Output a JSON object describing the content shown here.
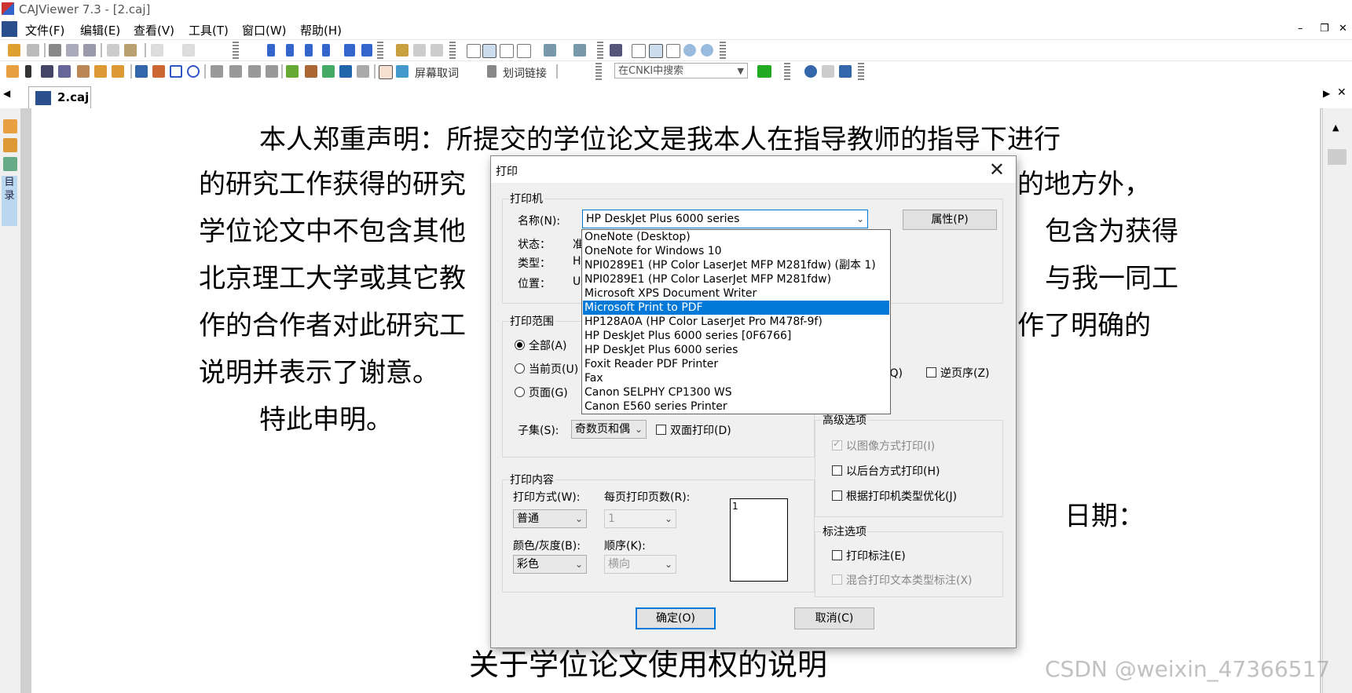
{
  "window": {
    "title": "CAJViewer 7.3 - [2.caj]"
  },
  "menubar": {
    "items": [
      "文件(F)",
      "编辑(E)",
      "查看(V)",
      "工具(T)",
      "窗口(W)",
      "帮助(H)"
    ]
  },
  "toolbar2": {
    "screen_fetch_label": "屏幕取词",
    "word_link_label": "划词链接",
    "search_placeholder": "在CNKI中搜索"
  },
  "tabs": [
    {
      "label": "2.caj"
    }
  ],
  "left_panel": {
    "toc_label": "目录"
  },
  "document": {
    "lines": [
      "本人郑重声明：所提交的学位论文是我本人在指导教师的指导下进行",
      "的研究工作获得的研究",
      "的地方外，",
      "学位论文中不包含其他",
      "包含为获得",
      "北京理工大学或其它教",
      "与我一同工",
      "作的合作者对此研究工",
      "作了明确的",
      "说明并表示了谢意。",
      "特此申明。",
      "日期：",
      "关于学位论文使用权的说明"
    ]
  },
  "dialog": {
    "title": "打印",
    "printer_group": "打印机",
    "name_label": "名称(N):",
    "printer_selected": "HP DeskJet Plus 6000 series",
    "properties_button": "属性(P)",
    "status_label": "状态：",
    "status_value": "准",
    "type_label": "类型：",
    "type_value": "H",
    "location_label": "位置：",
    "location_value": "U",
    "printer_options": [
      "OneNote (Desktop)",
      "OneNote for Windows 10",
      "NPI0289E1 (HP Color LaserJet MFP M281fdw) (副本 1)",
      "NPI0289E1 (HP Color LaserJet MFP M281fdw)",
      "Microsoft XPS Document Writer",
      "Microsoft Print to PDF",
      "HP128A0A (HP Color LaserJet Pro M478f-9f)",
      "HP DeskJet Plus 6000 series [0F6766]",
      "HP DeskJet Plus 6000 series",
      "Foxit Reader PDF Printer",
      "Fax",
      "Canon SELPHY CP1300 WS",
      "Canon E560 series Printer"
    ],
    "highlighted_option_index": 5,
    "range_group": "打印范围",
    "range_all": "全部(A)",
    "range_current": "当前页(U)",
    "range_pages": "页面(G)",
    "collate_label": "印(Q)",
    "reverse_label": "逆页序(Z)",
    "subset_label": "子集(S):",
    "subset_value": "奇数页和偶",
    "duplex_label": "双面打印(D)",
    "content_group": "打印内容",
    "print_mode_label": "打印方式(W):",
    "print_mode_value": "普通",
    "pages_per_sheet_label": "每页打印页数(R):",
    "pages_per_sheet_value": "1",
    "color_label": "颜色/灰度(B):",
    "color_value": "彩色",
    "order_label": "顺序(K):",
    "order_value": "横向",
    "preview_page_number": "1",
    "advanced_group": "高级选项",
    "adv_image_print": "以图像方式打印(I)",
    "adv_background_print": "以后台方式打印(H)",
    "adv_optimize": "根据打印机类型优化(J)",
    "annotation_group": "标注选项",
    "ann_print": "打印标注(E)",
    "ann_mixed": "混合打印文本类型标注(X)",
    "ok_button": "确定(O)",
    "cancel_button": "取消(C)"
  },
  "watermark": "CSDN @weixin_47366517",
  "colors": {
    "selection": "#0078d7",
    "toc_tab": "#bcd8f0"
  }
}
